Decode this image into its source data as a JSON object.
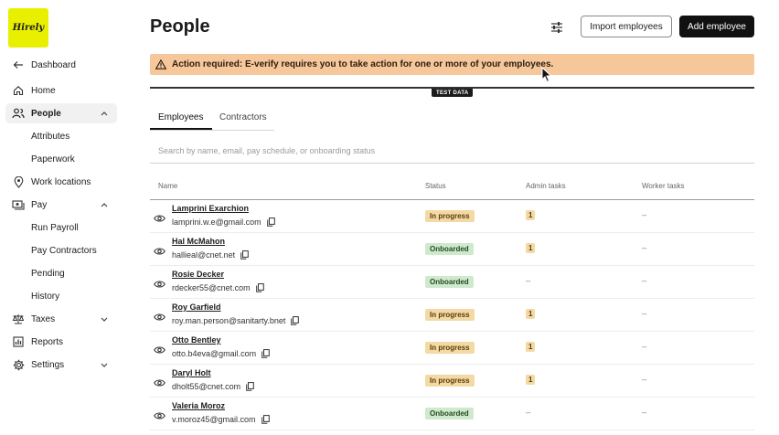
{
  "brand": {
    "logo_text": "Hirely",
    "logo_color": "#e8f000"
  },
  "sidebar": {
    "items": [
      {
        "label": "Dashboard",
        "icon": "arrow-left-icon",
        "type": "top",
        "chevron": ""
      },
      {
        "label": "Home",
        "icon": "home-icon",
        "type": "top",
        "chevron": ""
      },
      {
        "label": "People",
        "icon": "people-icon",
        "type": "active",
        "chevron": "^"
      },
      {
        "label": "Attributes",
        "icon": "",
        "type": "sub",
        "chevron": ""
      },
      {
        "label": "Paperwork",
        "icon": "",
        "type": "sub",
        "chevron": ""
      },
      {
        "label": "Work locations",
        "icon": "location-pin-icon",
        "type": "top",
        "chevron": ""
      },
      {
        "label": "Pay",
        "icon": "money-icon",
        "type": "top",
        "chevron": "^"
      },
      {
        "label": "Run Payroll",
        "icon": "",
        "type": "sub",
        "chevron": ""
      },
      {
        "label": "Pay Contractors",
        "icon": "",
        "type": "sub",
        "chevron": ""
      },
      {
        "label": "Pending",
        "icon": "",
        "type": "sub",
        "chevron": ""
      },
      {
        "label": "History",
        "icon": "",
        "type": "sub",
        "chevron": ""
      },
      {
        "label": "Taxes",
        "icon": "scale-icon",
        "type": "top",
        "chevron": "v"
      },
      {
        "label": "Reports",
        "icon": "chart-icon",
        "type": "top",
        "chevron": ""
      },
      {
        "label": "Settings",
        "icon": "gear-icon",
        "type": "top",
        "chevron": "v"
      }
    ]
  },
  "header": {
    "title": "People",
    "filter_icon": "sliders-icon",
    "import_label": "Import employees",
    "add_label": "Add employee"
  },
  "banner": {
    "text": "Action required: E-verify requires you to take action for one or more of your employees.",
    "icon": "warning-icon",
    "color": "#f6c79a"
  },
  "test_badge": "TEST DATA",
  "tabs": [
    {
      "label": "Employees",
      "active": true
    },
    {
      "label": "Contractors",
      "active": false
    }
  ],
  "search": {
    "placeholder": "Search by name, email, pay schedule, or onboarding status",
    "value": ""
  },
  "table": {
    "headers": {
      "name": "Name",
      "status": "Status",
      "admin": "Admin tasks",
      "worker": "Worker tasks"
    },
    "rows": [
      {
        "name": "Lamprini Exarchion",
        "email": "lamprini.w.e@gmail.com",
        "status": "In progress",
        "status_kind": "prog",
        "admin": "1",
        "worker": "--"
      },
      {
        "name": "Hal McMahon",
        "email": "hallieal@cnet.net",
        "status": "Onboarded",
        "status_kind": "onb",
        "admin": "1",
        "worker": "--"
      },
      {
        "name": "Rosie Decker",
        "email": "rdecker55@cnet.com",
        "status": "Onboarded",
        "status_kind": "onb",
        "admin": "--",
        "worker": "--"
      },
      {
        "name": "Roy Garfield",
        "email": "roy.man.person@sanitarty.bnet",
        "status": "In progress",
        "status_kind": "prog",
        "admin": "1",
        "worker": "--"
      },
      {
        "name": "Otto Bentley",
        "email": "otto.b4eva@gmail.com",
        "status": "In progress",
        "status_kind": "prog",
        "admin": "1",
        "worker": "--"
      },
      {
        "name": "Daryl Holt",
        "email": "dholt55@cnet.com",
        "status": "In progress",
        "status_kind": "prog",
        "admin": "1",
        "worker": "--"
      },
      {
        "name": "Valeria Moroz",
        "email": "v.moroz45@gmail.com",
        "status": "Onboarded",
        "status_kind": "onb",
        "admin": "--",
        "worker": "--"
      }
    ]
  }
}
